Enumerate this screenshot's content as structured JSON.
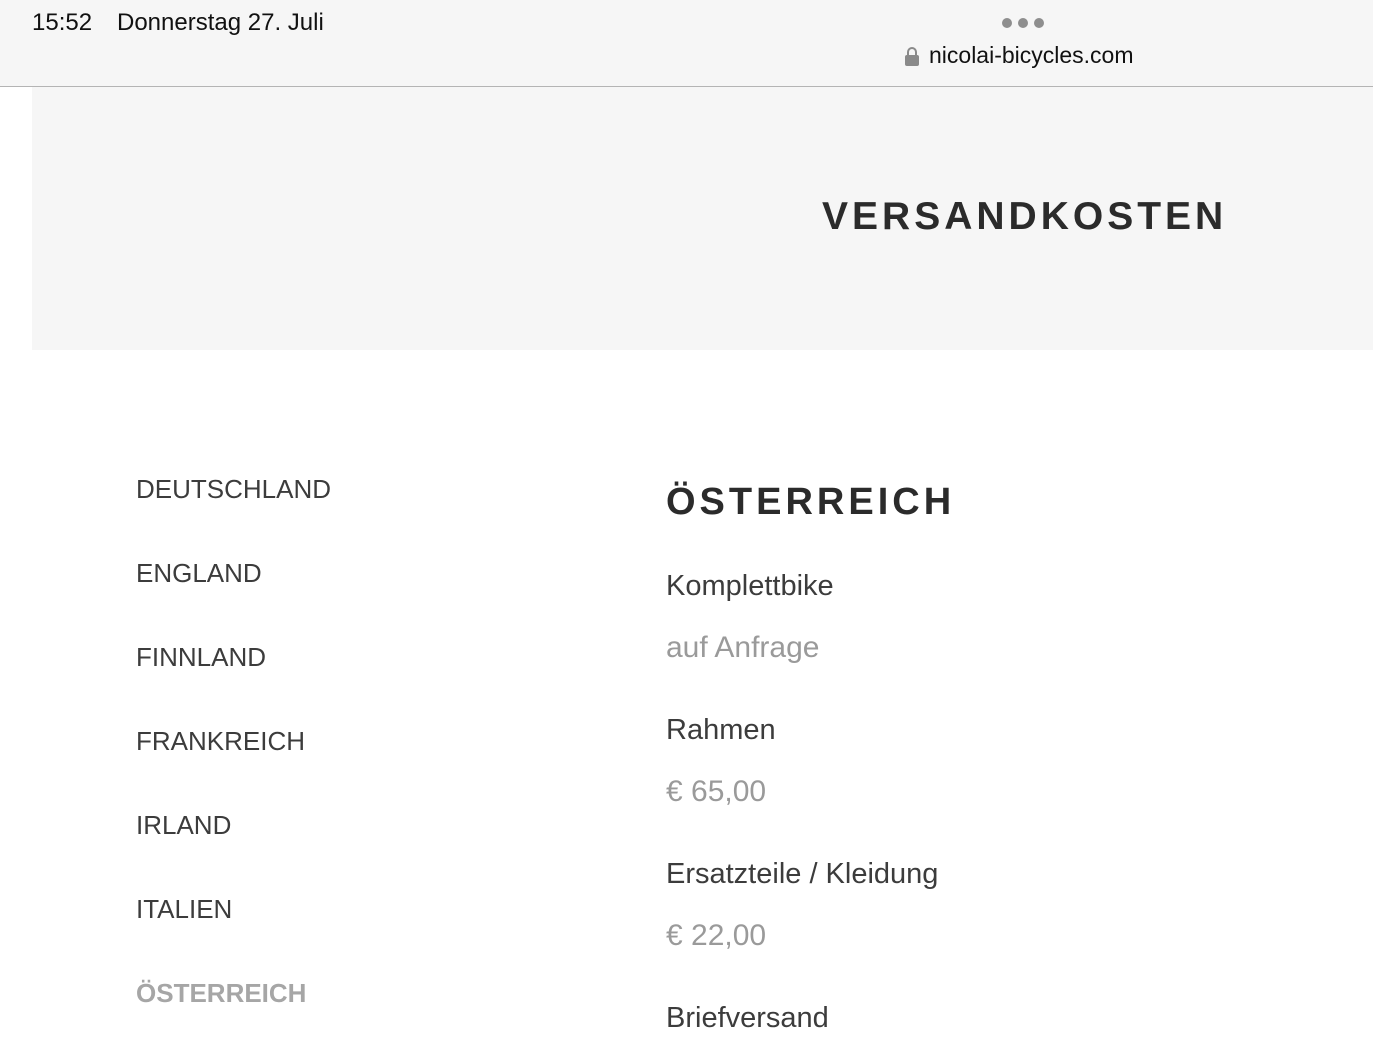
{
  "status_bar": {
    "time": "15:52",
    "date": "Donnerstag 27. Juli",
    "url": "nicolai-bicycles.com"
  },
  "hero": {
    "title": "VERSANDKOSTEN"
  },
  "countries": [
    {
      "label": "DEUTSCHLAND",
      "active": false
    },
    {
      "label": "ENGLAND",
      "active": false
    },
    {
      "label": "FINNLAND",
      "active": false
    },
    {
      "label": "FRANKREICH",
      "active": false
    },
    {
      "label": "IRLAND",
      "active": false
    },
    {
      "label": "ITALIEN",
      "active": false
    },
    {
      "label": "ÖSTERREICH",
      "active": true
    }
  ],
  "detail": {
    "title": "ÖSTERREICH",
    "items": [
      {
        "label": "Komplettbike",
        "value": "auf Anfrage"
      },
      {
        "label": "Rahmen",
        "value": "€ 65,00"
      },
      {
        "label": "Ersatzteile / Kleidung",
        "value": "€ 22,00"
      },
      {
        "label": "Briefversand",
        "value": ""
      }
    ]
  },
  "colors": {
    "active_country": "#a6a6a6",
    "hero_background": "#f6f6f6",
    "value_text": "#9a9a9a"
  }
}
